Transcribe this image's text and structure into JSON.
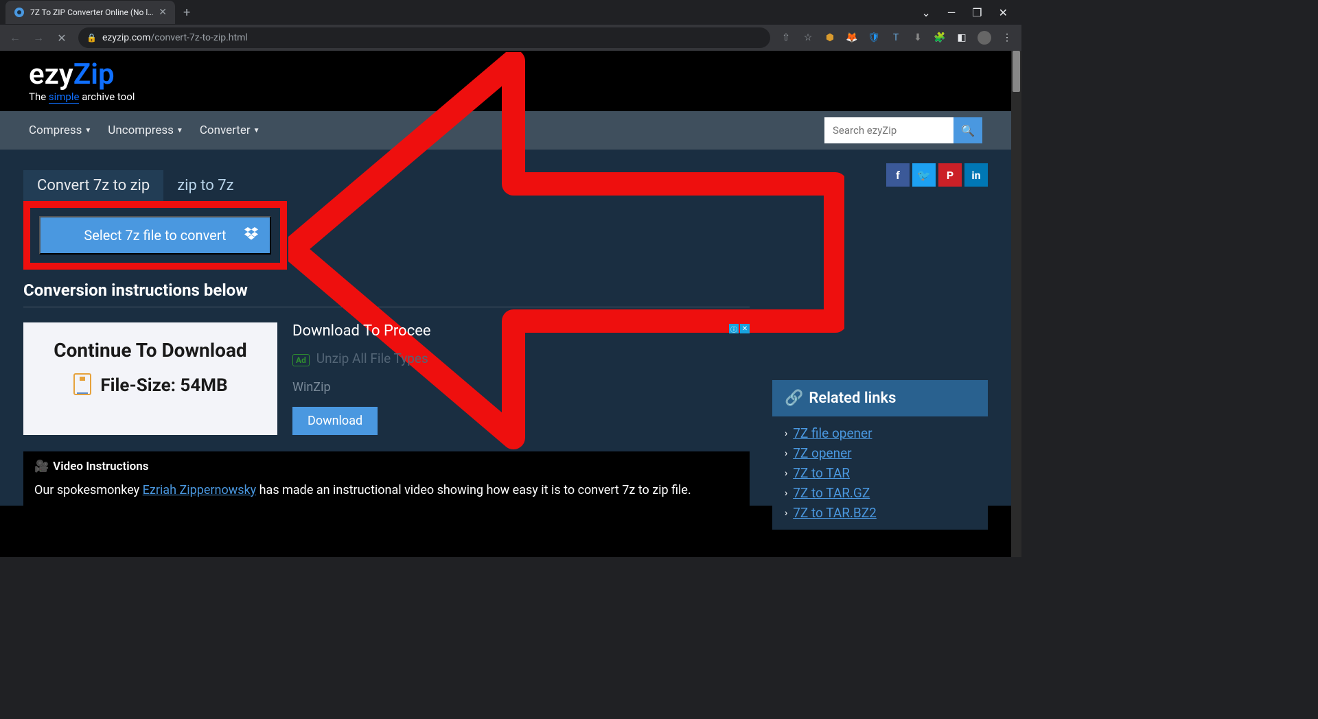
{
  "browser": {
    "tab_title": "7Z To ZIP Converter Online (No l…",
    "url_domain": "ezyzip.com",
    "url_path": "/convert-7z-to-zip.html"
  },
  "logo": {
    "ezy": "ezy",
    "zip": "Zip",
    "tagline_prefix": "The ",
    "tagline_simple": "simple",
    "tagline_suffix": " archive tool"
  },
  "menu": {
    "compress": "Compress",
    "uncompress": "Uncompress",
    "converter": "Converter"
  },
  "search": {
    "placeholder": "Search ezyZip"
  },
  "tabs": {
    "active": "Convert 7z to zip",
    "inactive": "zip to 7z"
  },
  "select_button": "Select 7z file to convert",
  "instructions_heading": "Conversion instructions below",
  "ad": {
    "title": "Continue To Download",
    "size": "File-Size: 54MB",
    "heading": "Download To Procee",
    "badge": "Ad",
    "unzip": "Unzip All File Types",
    "winzip": "WinZip",
    "download": "Download"
  },
  "video": {
    "title": "Video Instructions",
    "text_prefix": "Our spokesmonkey ",
    "link": "Ezriah Zippernowsky",
    "text_suffix": " has made an instructional video showing how easy it is to convert 7z to zip file."
  },
  "related": {
    "title": "Related links",
    "items": [
      "7Z file opener",
      "7Z opener",
      "7Z to TAR",
      "7Z to TAR.GZ",
      "7Z to TAR.BZ2"
    ]
  },
  "social": {
    "fb": "f",
    "tw": "🐦",
    "pin": "P",
    "li": "in"
  }
}
